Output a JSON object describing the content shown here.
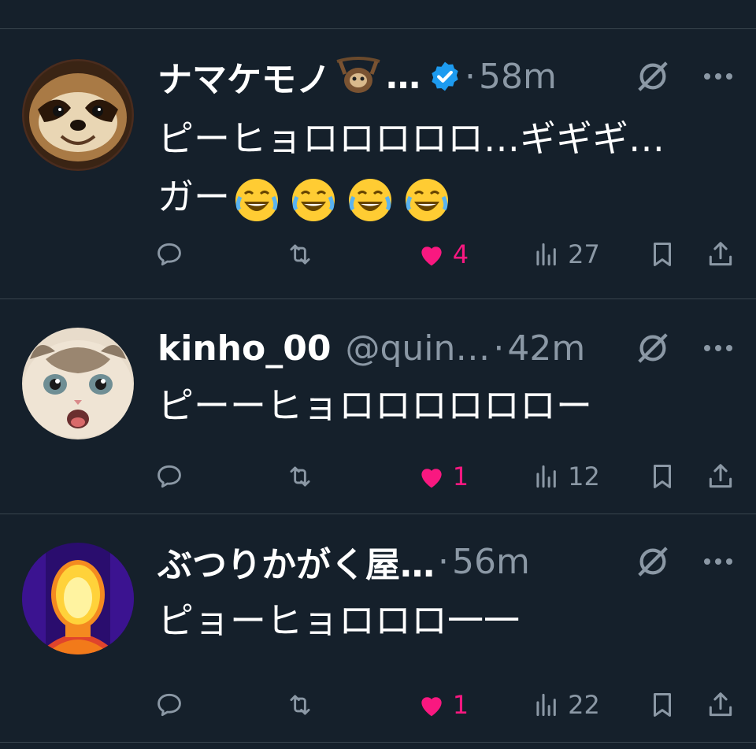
{
  "colors": {
    "background": "#15202b",
    "text": "#ffffff",
    "muted": "#8b98a5",
    "like": "#f91880",
    "verified": "#1d9bf0",
    "divider": "#38444d"
  },
  "replies": [
    {
      "name": "ナマケモノ",
      "name_suffix": "…",
      "handle": "",
      "time": "58m",
      "verified": true,
      "text_line1": "ピーヒョロロロロロ…ギギギ…",
      "text_line2": "ガー",
      "emoji_count": 4,
      "likes": "4",
      "views": "27"
    },
    {
      "name": "kinho_00",
      "handle": "@quin…",
      "time": "42m",
      "verified": false,
      "text_line1": "ピーーヒョロロロロロロー",
      "likes": "1",
      "views": "12"
    },
    {
      "name": "ぶつりかがく屋…",
      "handle": "",
      "time": "56m",
      "verified": false,
      "text_line1": "ピョーヒョロロロ一一",
      "likes": "1",
      "views": "22"
    }
  ],
  "icons": [
    "reply-icon",
    "retweet-icon",
    "heart-icon",
    "views-icon",
    "bookmark-icon",
    "share-icon",
    "grok-icon",
    "more-icon",
    "verified-badge-icon",
    "sloth-emoji",
    "joy-emoji"
  ]
}
